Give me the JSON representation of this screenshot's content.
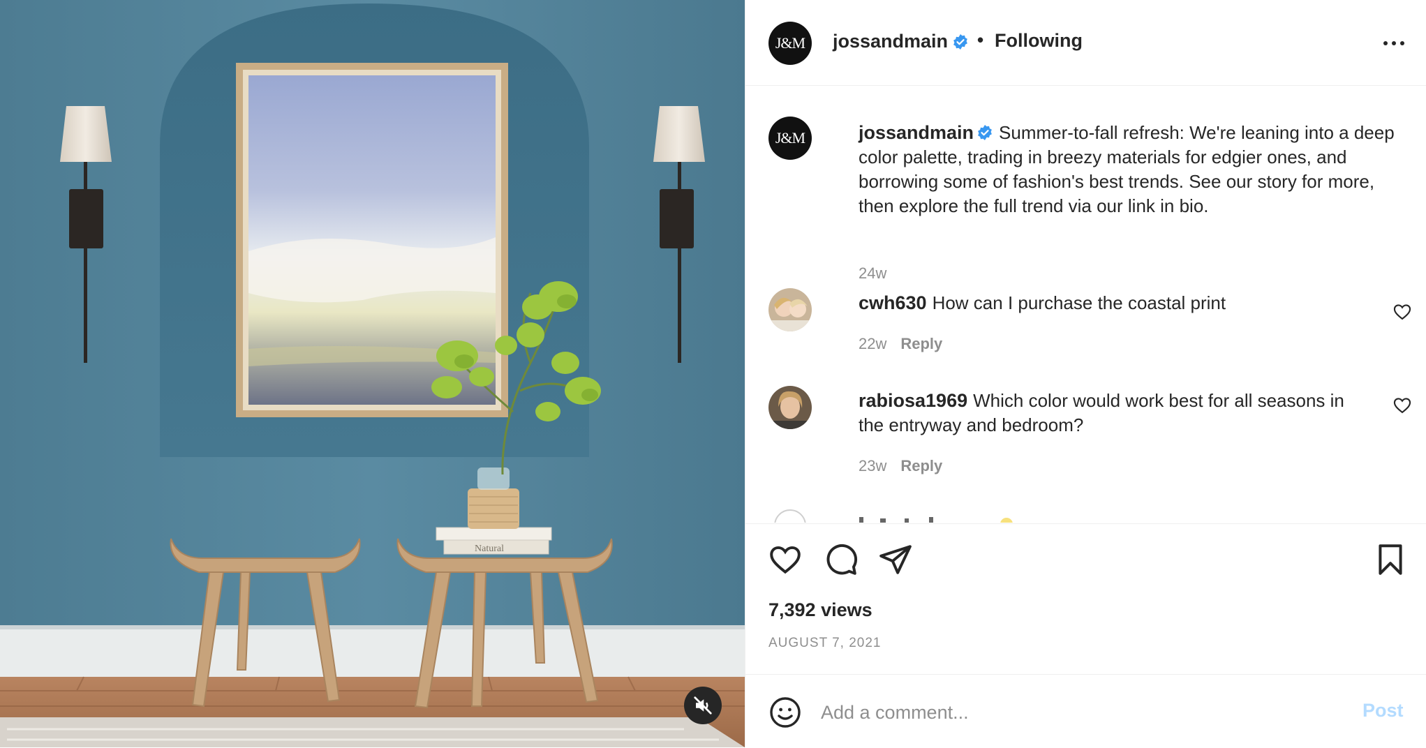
{
  "post": {
    "username": "jossandmain",
    "avatar_text": "J&M",
    "verified": true,
    "follow_state": "Following",
    "separator": "•",
    "caption": "Summer-to-fall refresh: We're leaning into a deep color palette, trading in breezy materials for edgier ones, and borrowing some of fashion's best trends. See our story for more, then explore the full trend via our link in bio.",
    "caption_time": "24w",
    "views": "7,392 views",
    "date": "AUGUST 7, 2021",
    "book_spine_text": "Natural"
  },
  "comments": [
    {
      "username": "cwh630",
      "text": "How can I purchase the coastal print",
      "time": "22w",
      "reply_label": "Reply"
    },
    {
      "username": "rabiosa1969",
      "text": "Which color would work best for all seasons in the entryway and bedroom?",
      "time": "23w",
      "reply_label": "Reply"
    }
  ],
  "add_comment": {
    "placeholder": "Add a comment...",
    "post_label": "Post"
  },
  "icons": {
    "more": "more-options-icon",
    "like": "heart-icon",
    "comment": "comment-bubble-icon",
    "share": "paper-plane-icon",
    "save": "bookmark-icon",
    "emoji": "smiley-icon",
    "mute": "speaker-muted-icon",
    "verified": "verified-badge-icon"
  },
  "colors": {
    "accent": "#0095f6",
    "post_disabled": "#b3dbff",
    "wall": "#4f7f97",
    "text_muted": "#8e8e8e"
  }
}
